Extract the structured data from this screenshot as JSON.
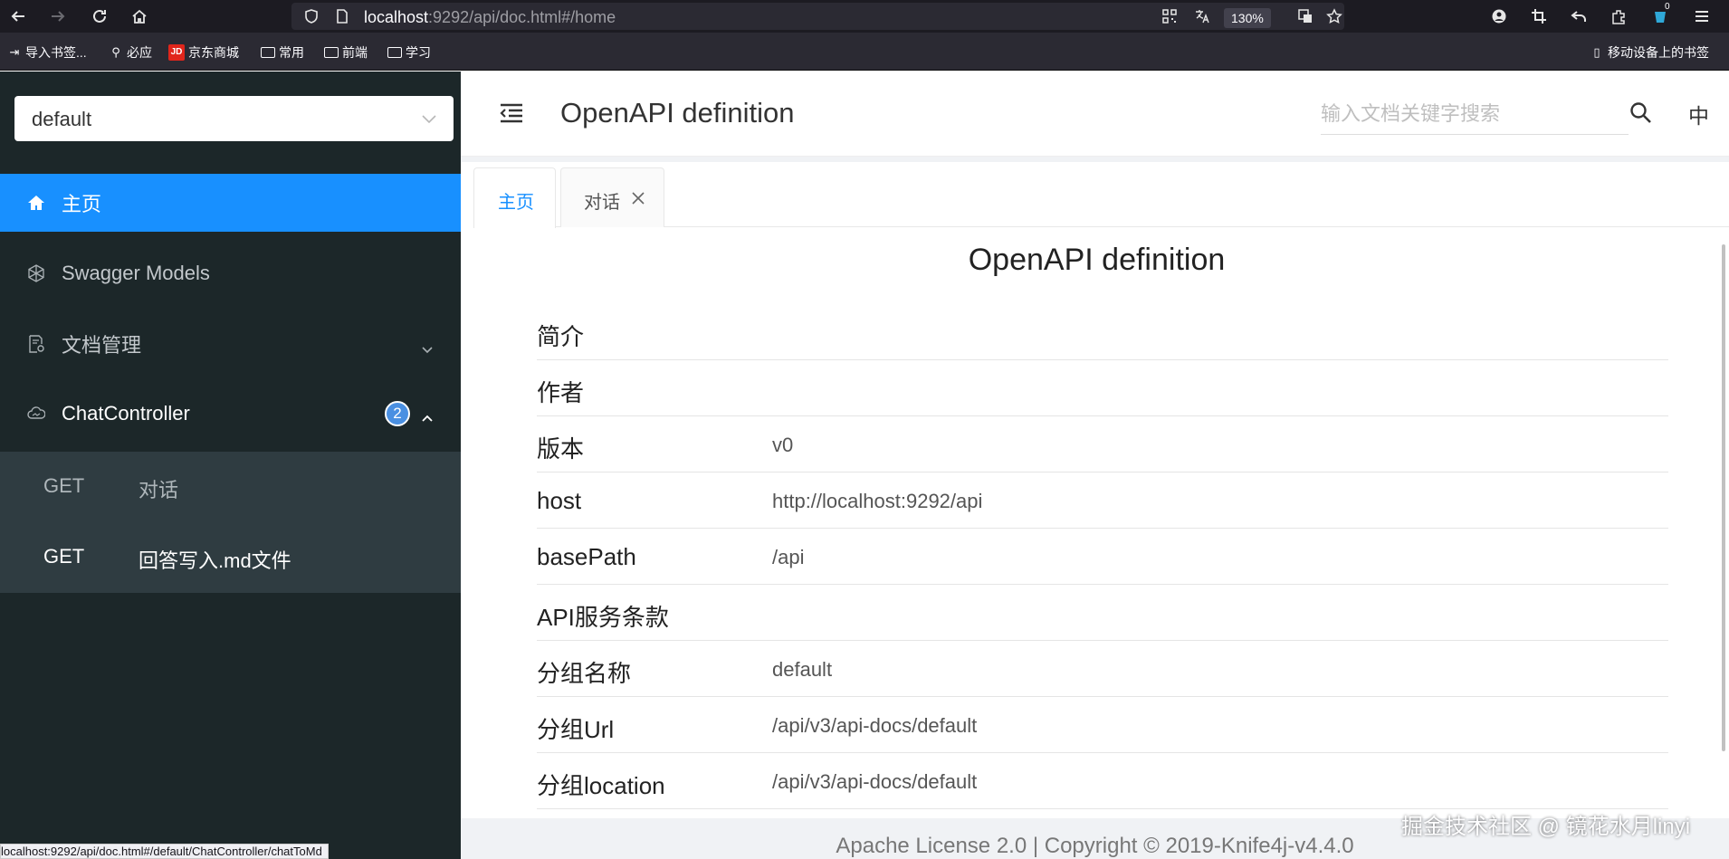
{
  "browser": {
    "url_host": "localhost",
    "url_rest": ":9292/api/doc.html#/home",
    "zoom": "130%",
    "extension_badge": "0",
    "status_url": "localhost:9292/api/doc.html#/default/ChatController/chatToMd",
    "icons": [
      "back-icon",
      "forward-icon",
      "reload-icon",
      "home-icon",
      "shield-icon",
      "page-icon",
      "qr-icon",
      "translate-icon",
      "translate-page-icon",
      "bookmark-star-icon",
      "account-icon",
      "crop-icon",
      "undo-icon",
      "extensions-icon",
      "extension-icon",
      "menu-icon"
    ]
  },
  "bookmarks": {
    "items": [
      "导入书签...",
      "必应",
      "京东商城",
      "常用",
      "前端",
      "学习"
    ],
    "mobile": "移动设备上的书签"
  },
  "sidebar": {
    "group_select": "default",
    "items": [
      {
        "label": "主页",
        "icon": "home-icon",
        "active": true
      },
      {
        "label": "Swagger Models",
        "icon": "cube-icon"
      },
      {
        "label": "文档管理",
        "icon": "doc-settings-icon"
      },
      {
        "label": "ChatController",
        "icon": "cloud-icon",
        "badge": "2"
      }
    ],
    "sub_items": [
      {
        "method": "GET",
        "label": "对话"
      },
      {
        "method": "GET",
        "label": "回答写入.md文件"
      }
    ]
  },
  "header": {
    "title": "OpenAPI definition",
    "search_placeholder": "输入文档关键字搜索",
    "lang": "中"
  },
  "tabs": [
    {
      "label": "主页",
      "active": true
    },
    {
      "label": "对话",
      "closable": true
    }
  ],
  "doc": {
    "title": "OpenAPI definition",
    "rows": [
      {
        "key": "简介",
        "value": ""
      },
      {
        "key": "作者",
        "value": ""
      },
      {
        "key": "版本",
        "value": "v0"
      },
      {
        "key": "host",
        "value": "http://localhost:9292/api"
      },
      {
        "key": "basePath",
        "value": "/api"
      },
      {
        "key": "API服务条款",
        "value": ""
      },
      {
        "key": "分组名称",
        "value": "default"
      },
      {
        "key": "分组Url",
        "value": "/api/v3/api-docs/default"
      },
      {
        "key": "分组location",
        "value": "/api/v3/api-docs/default"
      }
    ]
  },
  "footer": {
    "text": "Apache License 2.0 | Copyright © 2019-Knife4j-v4.4.0"
  },
  "watermark": "掘金技术社区 @ 镜花水月linyi",
  "colors": {
    "sidebar_bg": "#1c2729",
    "active_blue": "#1890ff",
    "submenu_bg": "#2f3c41"
  }
}
